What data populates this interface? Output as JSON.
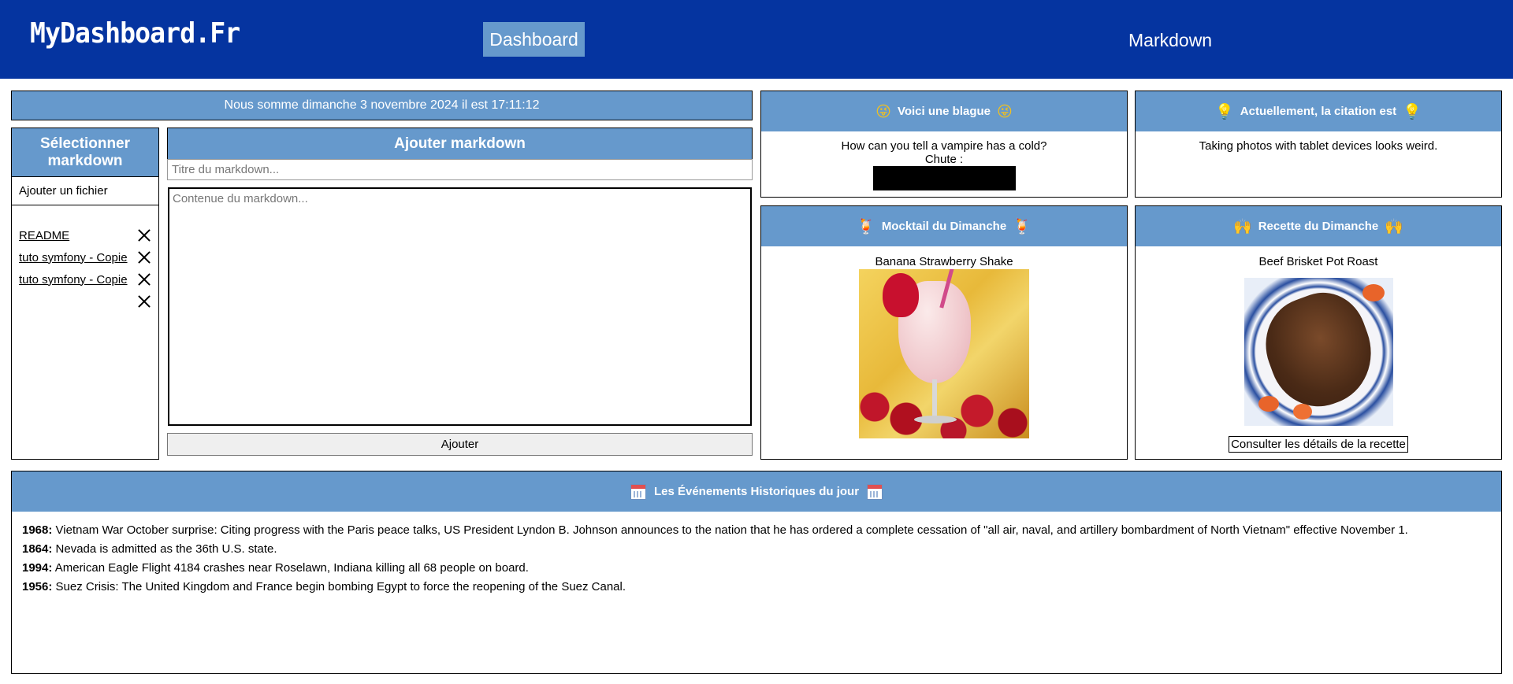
{
  "header": {
    "logo": "MyDashboard.Fr",
    "nav": {
      "dashboard": "Dashboard",
      "markdown": "Markdown"
    }
  },
  "datebar": {
    "text": "Nous somme dimanche 3 novembre 2024 il est 17:11:12"
  },
  "select_markdown": {
    "title": "Sélectionner markdown",
    "add_file": "Ajouter un fichier",
    "items": [
      {
        "label": "README"
      },
      {
        "label": "tuto symfony - Copie"
      },
      {
        "label": "tuto symfony - Copie"
      },
      {
        "label": ""
      }
    ]
  },
  "add_markdown": {
    "title": "Ajouter markdown",
    "title_placeholder": "Titre du markdown...",
    "content_placeholder": "Contenue du markdown...",
    "submit": "Ajouter"
  },
  "joke": {
    "title": "Voici une blague",
    "emoji": "😜",
    "question": "How can you tell a vampire has a cold?",
    "chute_label": "Chute :"
  },
  "quote": {
    "title": "Actuellement, la citation est",
    "emoji": "💡",
    "text": "Taking photos with tablet devices looks weird."
  },
  "mocktail": {
    "title": "Mocktail du Dimanche",
    "emoji": "🍹",
    "name": "Banana Strawberry Shake"
  },
  "recipe": {
    "title": "Recette du Dimanche",
    "emoji": "🙌",
    "name": "Beef Brisket Pot Roast",
    "button": "Consulter les détails de la recette"
  },
  "history": {
    "title": "Les Événements Historiques du jour",
    "events": [
      {
        "year": "1968:",
        "text": " Vietnam War October surprise: Citing progress with the Paris peace talks, US President Lyndon B. Johnson announces to the nation that he has ordered a complete cessation of \"all air, naval, and artillery bombardment of North Vietnam\" effective November 1."
      },
      {
        "year": "1864:",
        "text": " Nevada is admitted as the 36th U.S. state."
      },
      {
        "year": "1994:",
        "text": " American Eagle Flight 4184 crashes near Roselawn, Indiana killing all 68 people on board."
      },
      {
        "year": "1956:",
        "text": " Suez Crisis: The United Kingdom and France begin bombing Egypt to force the reopening of the Suez Canal."
      }
    ]
  },
  "colors": {
    "topbar": "#0534a0",
    "accent": "#6699cc"
  }
}
